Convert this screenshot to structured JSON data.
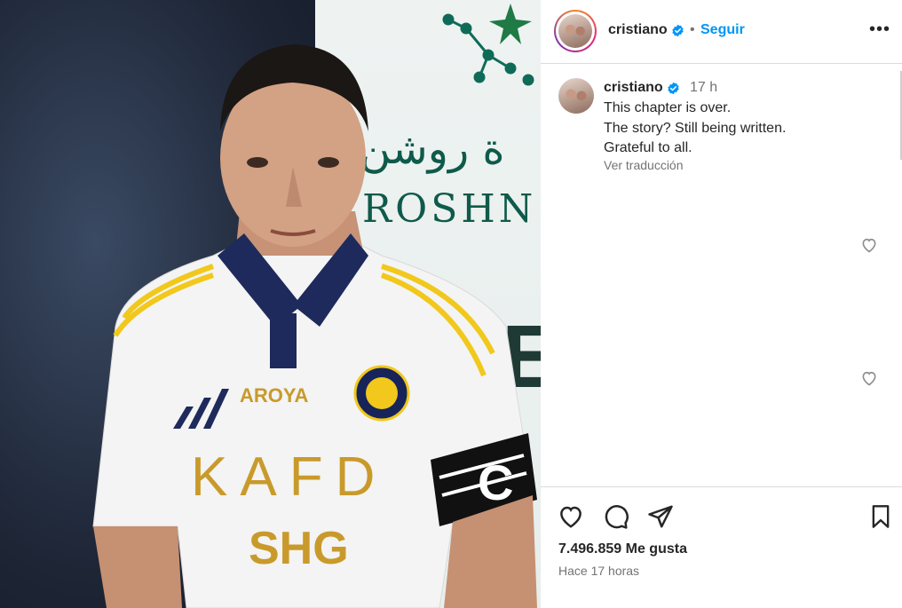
{
  "post": {
    "photo": {
      "banner_arabic": "ة روشن",
      "banner_latin": "ROSHN C",
      "banner_letter": "E",
      "jersey_sponsor_top": "AROYA",
      "jersey_sponsor_main": "KAFD",
      "jersey_sponsor_bottom": "SHG",
      "captain_band": "C"
    },
    "header": {
      "username": "cristiano",
      "separator": "•",
      "follow_label": "Seguir",
      "more_label": "•••"
    },
    "caption": {
      "username": "cristiano",
      "time": "17 h",
      "lines": [
        "This chapter is over.",
        "The story? Still being written.",
        "Grateful to all."
      ],
      "translate_label": "Ver traducción"
    },
    "likes": "7.496.859 Me gusta",
    "timestamp": "Hace 17 horas"
  },
  "colors": {
    "accent": "#0095f6",
    "verified": "#0095f6",
    "text": "#262626",
    "muted": "#737373",
    "border": "#dbdbdb"
  },
  "icons": [
    "verified-badge-icon",
    "more-options-icon",
    "heart-icon",
    "comment-icon",
    "share-icon",
    "bookmark-icon"
  ]
}
